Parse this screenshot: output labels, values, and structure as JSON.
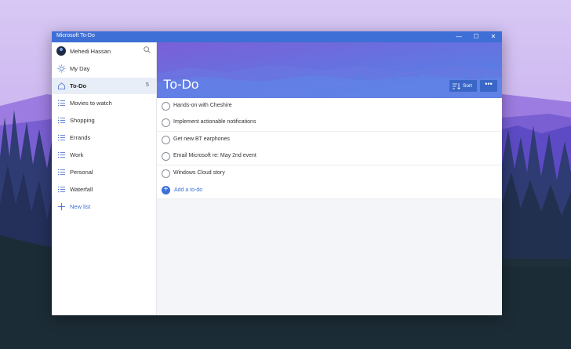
{
  "window": {
    "title": "Microsoft To-Do",
    "controls": {
      "minimize": "—",
      "maximize": "☐",
      "close": "✕"
    }
  },
  "profile": {
    "name": "Mehedi Hassan"
  },
  "sidebar": {
    "items": [
      {
        "label": "My Day",
        "icon": "sun-icon"
      },
      {
        "label": "To-Do",
        "icon": "home-icon",
        "count": "5",
        "active": true
      },
      {
        "label": "Movies to watch",
        "icon": "list-icon"
      },
      {
        "label": "Shopping",
        "icon": "list-icon"
      },
      {
        "label": "Errands",
        "icon": "list-icon"
      },
      {
        "label": "Work",
        "icon": "list-icon"
      },
      {
        "label": "Personal",
        "icon": "list-icon"
      },
      {
        "label": "Waterfall",
        "icon": "list-icon"
      }
    ],
    "new_list": {
      "label": "New list",
      "icon": "plus-icon"
    }
  },
  "main": {
    "title": "To-Do",
    "sort_label": "Sort",
    "more_label": "•••",
    "tasks": [
      {
        "text": "Hands-on with Cheshire"
      },
      {
        "text": "Implement actionable notifications"
      },
      {
        "text": "Get new BT earphones"
      },
      {
        "text": "Email Microsoft re: May 2nd event"
      },
      {
        "text": "Windows Cloud story"
      }
    ],
    "add_placeholder": "Add a to-do"
  },
  "colors": {
    "accent": "#3d6fd6",
    "banner_top": "#7b5fd8",
    "banner_bottom": "#4f86e8"
  }
}
